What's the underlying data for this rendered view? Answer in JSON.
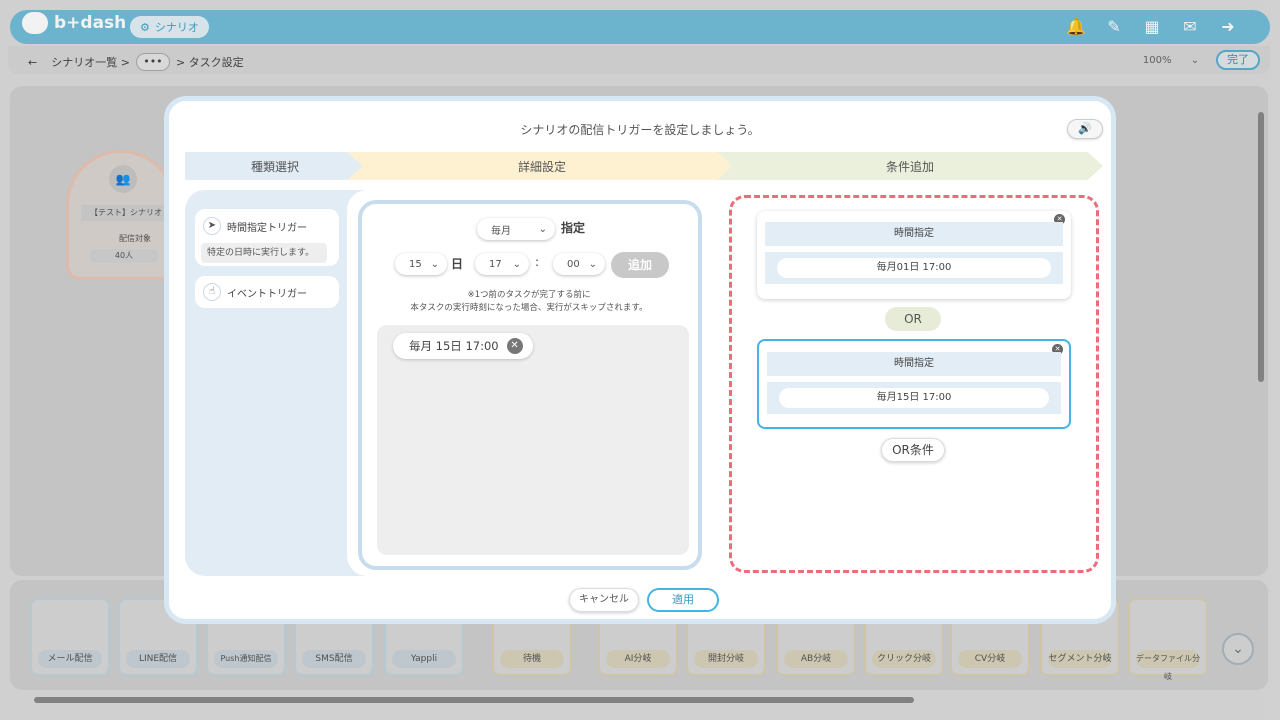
{
  "app": {
    "logo_text": "b+dash",
    "scenario_chip": "シナリオ"
  },
  "header_icons": [
    "bell-icon",
    "wrench-icon",
    "grid-icon",
    "chat-icon",
    "logout-icon"
  ],
  "breadcrumb": {
    "back": "←",
    "item1": "シナリオ一覧 >",
    "ellipsis": "•••",
    "item2": "> タスク設定"
  },
  "zoom": {
    "value": "100%"
  },
  "done_label": "完了",
  "background_node": {
    "title": "【テスト】シナリオ",
    "target": "配信対象",
    "count": "40人"
  },
  "palette": [
    {
      "label": "メール配信",
      "style": "blue"
    },
    {
      "label": "LINE配信",
      "style": "blue"
    },
    {
      "label": "Push通知配信",
      "style": "blue"
    },
    {
      "label": "SMS配信",
      "style": "blue"
    },
    {
      "label": "Yappli",
      "style": "blue"
    },
    {
      "label": "待機",
      "style": "yellow"
    },
    {
      "label": "AI分岐",
      "style": "yellow"
    },
    {
      "label": "開封分岐",
      "style": "yellow"
    },
    {
      "label": "AB分岐",
      "style": "yellow"
    },
    {
      "label": "クリック分岐",
      "style": "yellow"
    },
    {
      "label": "CV分岐",
      "style": "yellow"
    },
    {
      "label": "セグメント分岐",
      "style": "yellow"
    },
    {
      "label": "データファイル分岐",
      "style": "yellow"
    }
  ],
  "modal": {
    "title": "シナリオの配信トリガーを設定しましょう。",
    "steps": [
      "種類選択",
      "詳細設定",
      "条件追加"
    ],
    "triggers": {
      "time_label": "時間指定トリガー",
      "time_desc": "特定の日時に実行します。",
      "event_label": "イベントトリガー"
    },
    "detail": {
      "frequency": "毎月",
      "shitei": "指定",
      "day": "15",
      "day_unit": "日",
      "hour": "17",
      "colon": ":",
      "minute": "00",
      "add_label": "追加",
      "note_line1": "※1つ前のタスクが完了する前に",
      "note_line2": "本タスクの実行時刻になった場合、実行がスキップされます。",
      "selected_tag": "毎月 15日 17:00"
    },
    "conditions": [
      {
        "header": "時間指定",
        "value": "毎月01日 17:00"
      },
      {
        "header": "時間指定",
        "value": "毎月15日 17:00"
      }
    ],
    "or_label": "OR",
    "or_condition_label": "OR条件",
    "cancel_label": "キャンセル",
    "apply_label": "適用"
  }
}
